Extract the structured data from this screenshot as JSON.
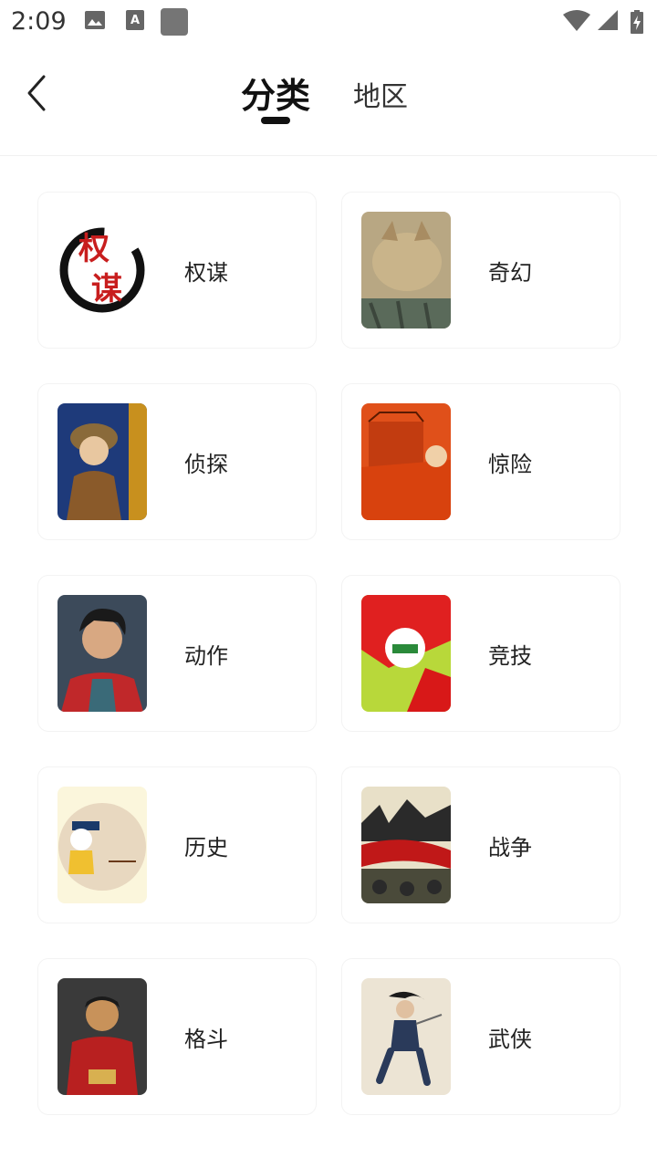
{
  "status_bar": {
    "time": "2:09",
    "icons": [
      "image-icon",
      "a-notification-icon",
      "square-icon",
      "wifi-icon",
      "signal-icon",
      "battery-charging-icon"
    ]
  },
  "header": {
    "back_icon": "chevron-left-icon",
    "tabs": [
      {
        "label": "分类",
        "active": true
      },
      {
        "label": "地区",
        "active": false
      }
    ]
  },
  "categories": [
    {
      "label": "权谋",
      "cover_text": "权谋"
    },
    {
      "label": "奇幻"
    },
    {
      "label": "侦探"
    },
    {
      "label": "惊险"
    },
    {
      "label": "动作"
    },
    {
      "label": "竞技"
    },
    {
      "label": "历史"
    },
    {
      "label": "战争"
    },
    {
      "label": "格斗"
    },
    {
      "label": "武侠"
    }
  ],
  "colors": {
    "text_primary": "#111111",
    "text_secondary": "#222222",
    "card_border": "#f3f3f3"
  }
}
